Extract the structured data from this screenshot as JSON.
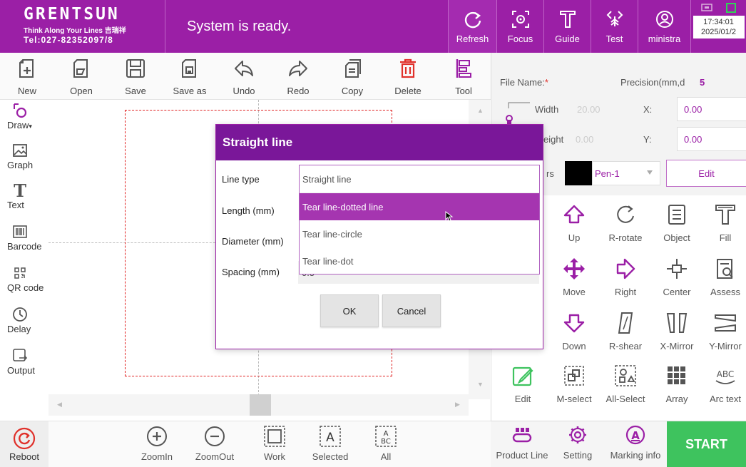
{
  "header": {
    "brand_name": "GRENTSUN",
    "brand_slogan": "Think Along Your Lines 吉瑞祥",
    "brand_tel": "Tel:027-82352097/8",
    "status": "System is ready.",
    "buttons": [
      {
        "label": "Refresh",
        "icon": "refresh-icon"
      },
      {
        "label": "Focus",
        "icon": "focus-icon"
      },
      {
        "label": "Guide",
        "icon": "guide-icon"
      },
      {
        "label": "Test",
        "icon": "test-icon"
      },
      {
        "label": "ministra",
        "icon": "user-icon"
      }
    ],
    "time": "17:34:01",
    "date": "2025/01/2"
  },
  "toolbar": {
    "items": [
      "New",
      "Open",
      "Save",
      "Save as",
      "Undo",
      "Redo",
      "Copy",
      "Delete",
      "Tool"
    ]
  },
  "sidebar": {
    "items": [
      "Draw",
      "Graph",
      "Text",
      "Barcode",
      "QR code",
      "Delay",
      "Output"
    ]
  },
  "bottombar": {
    "reboot": "Reboot",
    "zoom": [
      "ZoomIn",
      "ZoomOut",
      "Work",
      "Selected",
      "All"
    ]
  },
  "right_panel": {
    "file_name_label": "File Name:",
    "required_mark": "*",
    "precision_label": "Precision(mm,d",
    "precision_value": "5",
    "width_label": "Width",
    "width_value": "20.00",
    "height_label": "eight",
    "height_value": "0.00",
    "x_label": "X:",
    "x_value": "0.00",
    "y_label": "Y:",
    "y_value": "0.00",
    "pens_label": "rs",
    "pen_value": "Pen-1",
    "edit_label": "Edit",
    "grid": [
      "Up",
      "R-rotate",
      "Object",
      "Fill",
      "Move",
      "Right",
      "Center",
      "Assess",
      "Down",
      "R-shear",
      "X-Mirror",
      "Y-Mirror",
      "Edit",
      "M-select",
      "All-Select",
      "Array",
      "Arc text"
    ]
  },
  "right_bottom": {
    "items": [
      "Product Line",
      "Setting",
      "Marking info"
    ],
    "start": "START"
  },
  "dialog": {
    "title": "Straight line",
    "line_type_label": "Line type",
    "length_label": "Length (mm)",
    "diameter_label": "Diameter (mm)",
    "spacing_label": "Spacing (mm)",
    "spacing_value": "0.5",
    "dropdown_current": "Straight line",
    "options": [
      "Tear line-dotted line",
      "Tear line-circle",
      "Tear line-dot"
    ],
    "ok": "OK",
    "cancel": "Cancel"
  },
  "colors": {
    "accent": "#9b1fa6",
    "dialog_title": "#7a1799",
    "selected_option": "#a535b0",
    "start": "#3ec35e",
    "work_border": "#e02020"
  }
}
